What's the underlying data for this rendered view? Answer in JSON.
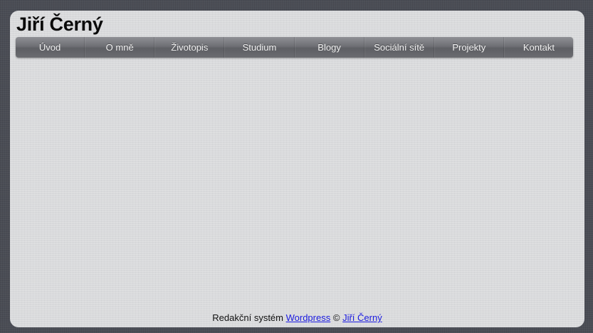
{
  "header": {
    "site_title": "Jiří Černý"
  },
  "nav": {
    "items": [
      {
        "label": "Úvod"
      },
      {
        "label": "O mně"
      },
      {
        "label": "Životopis"
      },
      {
        "label": "Studium"
      },
      {
        "label": "Blogy"
      },
      {
        "label": "Sociální sítě"
      },
      {
        "label": "Projekty"
      },
      {
        "label": "Kontakt"
      }
    ]
  },
  "footer": {
    "prefix": "Redakční systém",
    "wordpress_link": "Wordpress",
    "copyright": "©",
    "author_link": "Jiří Černý"
  },
  "colors": {
    "background": "#4a4d55",
    "panel": "#d9dadc",
    "nav_bar": "#6e6f74",
    "link": "#1a1ae0"
  }
}
